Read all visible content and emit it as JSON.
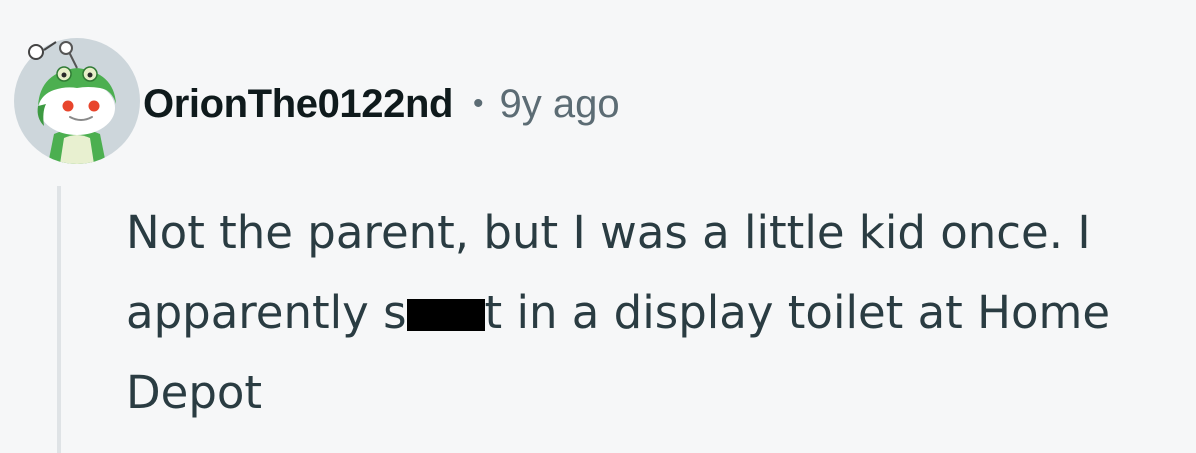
{
  "comment": {
    "username": "OrionThe0122nd",
    "separator": "•",
    "timestamp": "9y ago",
    "avatar_icon": "snoo-frog-hood-avatar",
    "body_before_redaction": "Not the parent, but I was a little kid once. I apparently s",
    "body_after_redaction": "t in a display toilet at Home Depot"
  },
  "colors": {
    "background": "#f6f7f8",
    "username": "#0f1a1c",
    "meta": "#5c6c74",
    "body_text": "#2a3c42",
    "thread_line": "#dfe3e6",
    "avatar_green": "#4caf50",
    "avatar_bg": "#cdd6db"
  }
}
